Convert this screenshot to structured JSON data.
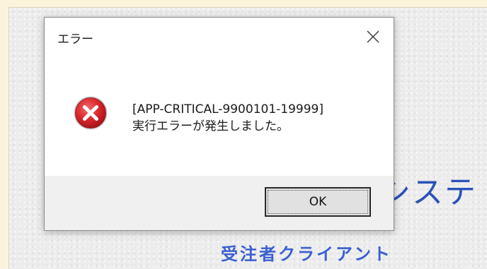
{
  "background_app": {
    "system_text": "システ",
    "client_text": "受注者クライアント"
  },
  "dialog": {
    "title": "エラー",
    "icon": "error-icon",
    "message_line1": "[APP-CRITICAL-9900101-19999]",
    "message_line2": "実行エラーが発生しました。",
    "ok_label": "OK",
    "close_icon": "close-icon"
  },
  "colors": {
    "error_red": "#d9262c",
    "accent_blue": "#2a52b8",
    "dialog_footer": "#f0f0f0"
  }
}
